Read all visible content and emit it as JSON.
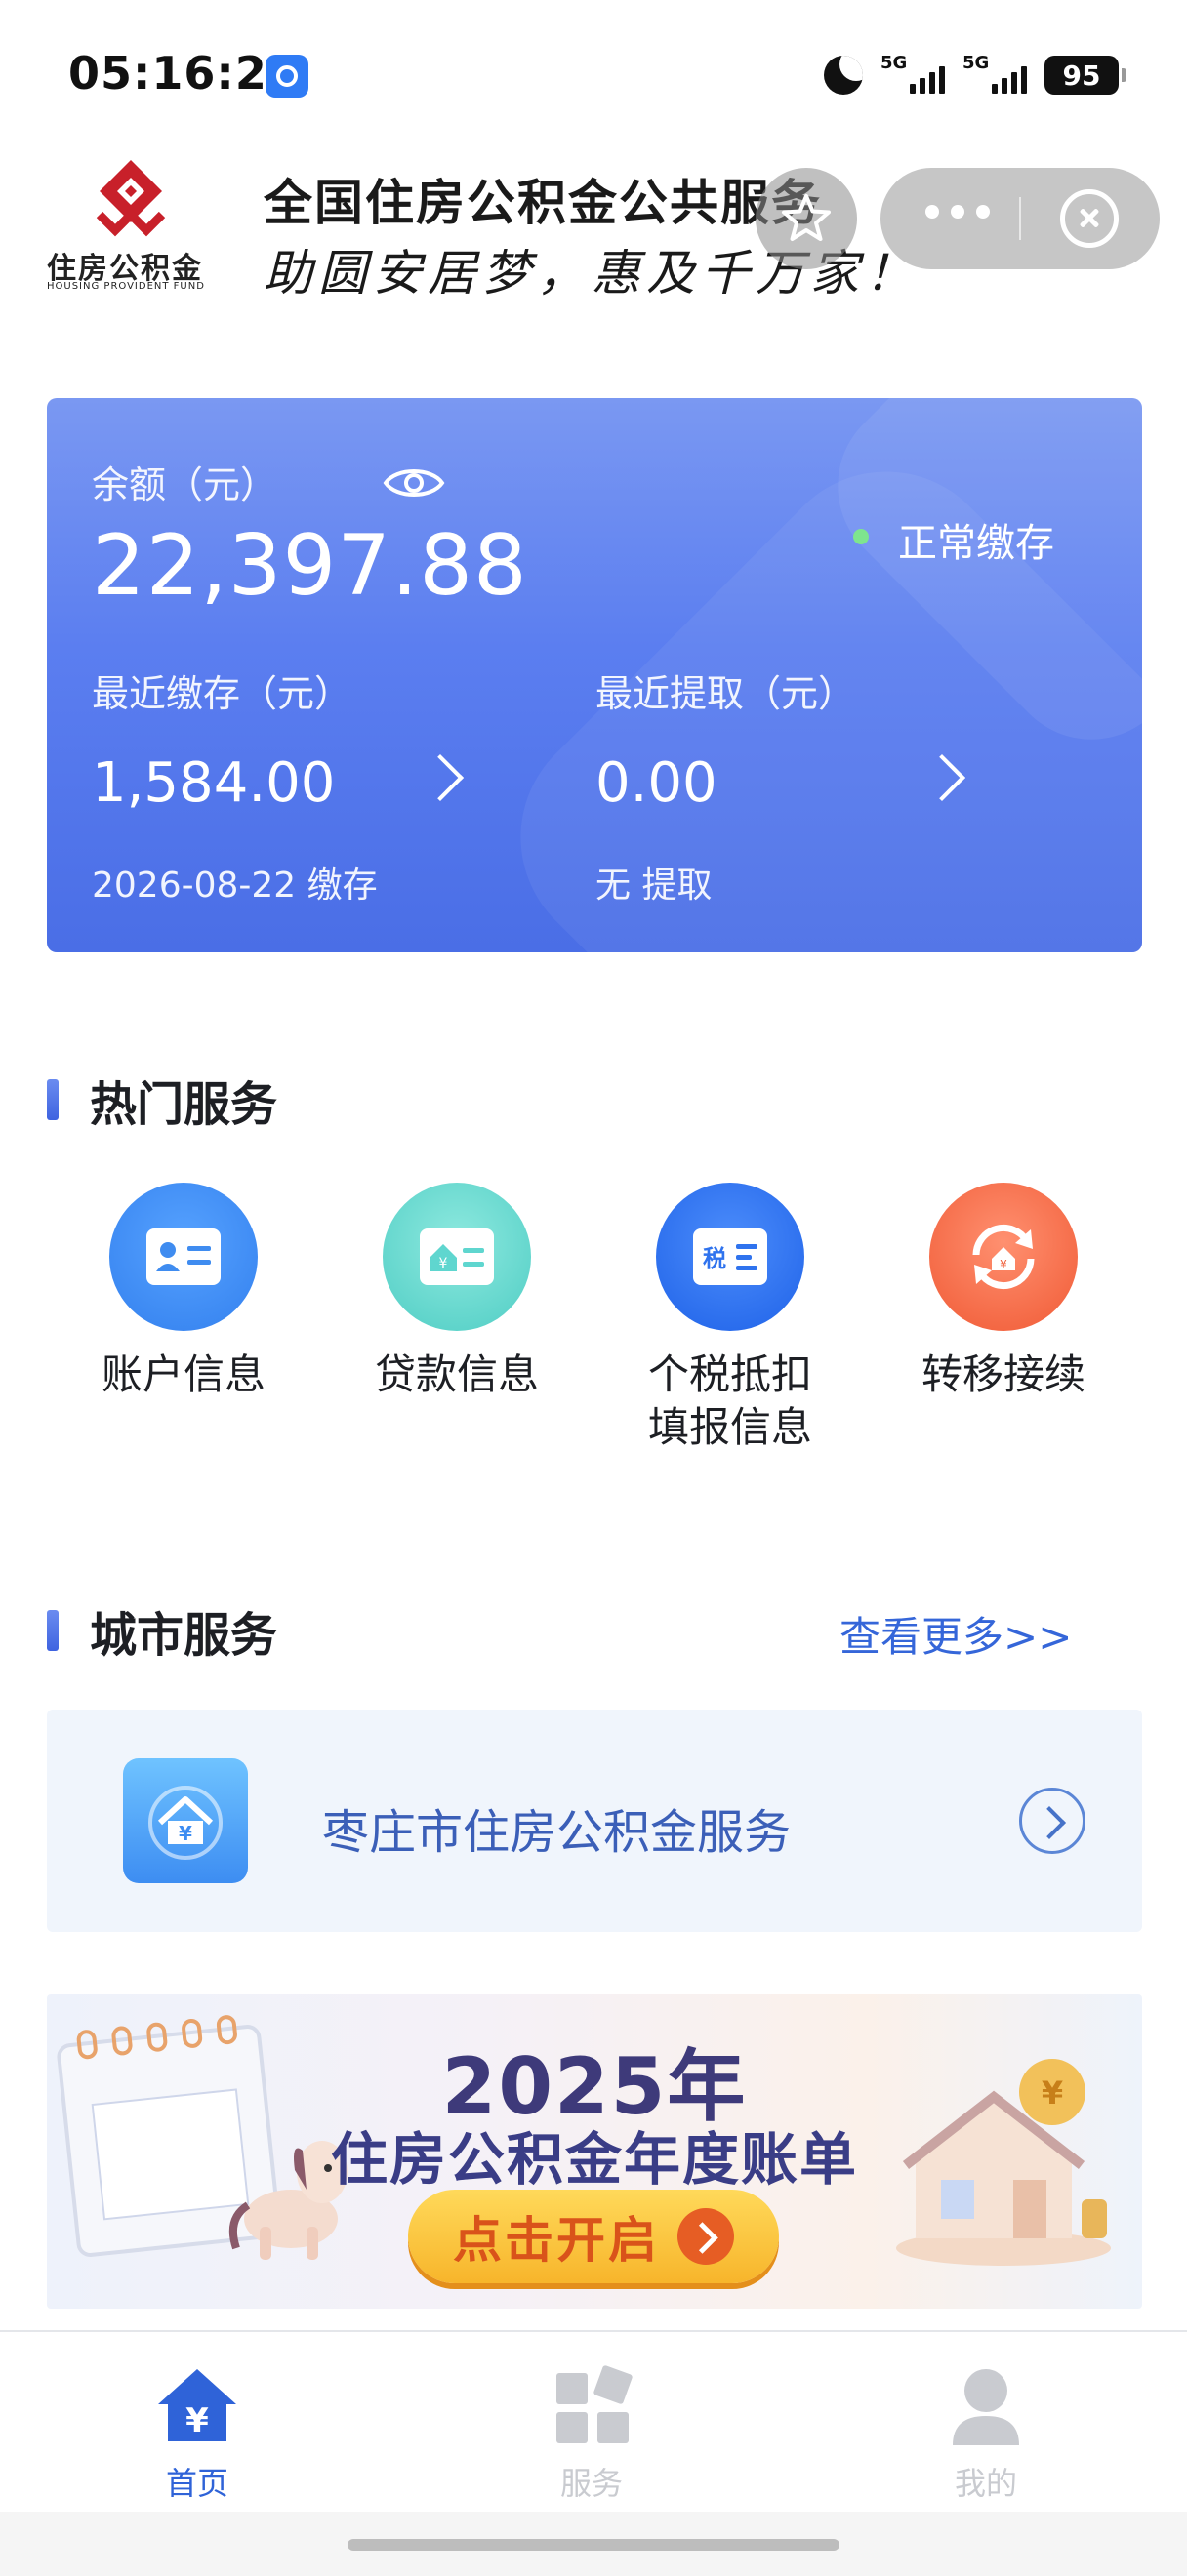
{
  "status_bar": {
    "time": "05:16:21",
    "network1": "5G",
    "network2": "5G",
    "battery": "95"
  },
  "header": {
    "logo_text": "住房公积金",
    "logo_sub": "HOUSING PROVIDENT FUND",
    "title": "全国住房公积金公共服务",
    "slogan": "助圆安居梦，惠及千万家！"
  },
  "account": {
    "balance_label": "余额（元）",
    "balance_value": "22,397.88",
    "status": "正常缴存",
    "recent_deposit_label": "最近缴存（元）",
    "recent_deposit_value": "1,584.00",
    "recent_deposit_note": "2026-08-22 缴存",
    "recent_withdraw_label": "最近提取（元）",
    "recent_withdraw_value": "0.00",
    "recent_withdraw_note": "无 提取"
  },
  "hot_services": {
    "title": "热门服务",
    "items": [
      {
        "label": "账户信息",
        "icon": "id-card-icon",
        "color": "#3f8cf0"
      },
      {
        "label": "贷款信息",
        "icon": "loan-card-icon",
        "color": "#5fd6cf"
      },
      {
        "label": "个税抵扣\n填报信息",
        "icon": "tax-icon",
        "color": "#2f73ee"
      },
      {
        "label": "转移接续",
        "icon": "transfer-icon",
        "color": "#f56b44"
      }
    ]
  },
  "city_services": {
    "title": "城市服务",
    "more_label": "查看更多>>",
    "item_label": "枣庄市住房公积金服务"
  },
  "banner": {
    "year": "2025年",
    "title": "住房公积金年度账单",
    "button_label": "点击开启"
  },
  "tabbar": {
    "tabs": [
      {
        "label": "首页",
        "active": true
      },
      {
        "label": "服务",
        "active": false
      },
      {
        "label": "我的",
        "active": false
      }
    ],
    "active_color": "#2f63d8",
    "inactive_color": "#c9cbd0"
  }
}
